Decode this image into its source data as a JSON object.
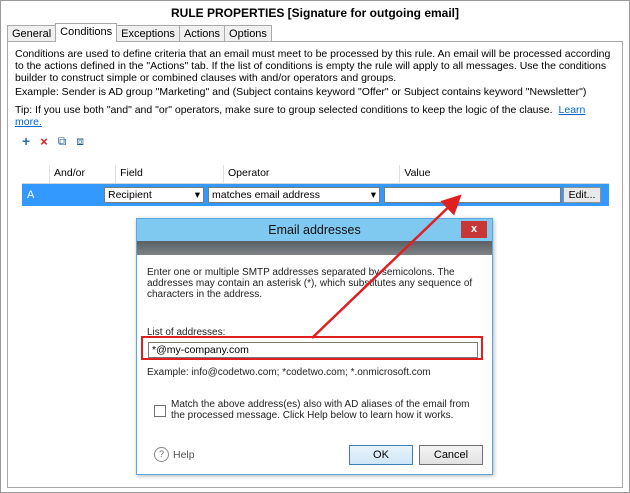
{
  "window": {
    "title": "RULE PROPERTIES [Signature for outgoing email]"
  },
  "tabs": [
    {
      "label": "General"
    },
    {
      "label": "Conditions"
    },
    {
      "label": "Exceptions"
    },
    {
      "label": "Actions"
    },
    {
      "label": "Options"
    }
  ],
  "active_tab": "Conditions",
  "description": {
    "para1": "Conditions are used to define criteria that an email must meet to be processed by this rule. An email will be processed according to the actions defined in the \"Actions\" tab. If the list of conditions is empty the rule will apply to all messages. Use the conditions builder to construct simple or combined clauses with and/or operators and groups.",
    "example": "Example: Sender is AD group \"Marketing\" and (Subject contains keyword \"Offer\" or Subject contains keyword \"Newsletter\")",
    "tip": "Tip: If you use both \"and\" and \"or\" operators, make sure to group selected conditions to keep the logic of the clause.",
    "learn_more": "Learn more."
  },
  "toolbar": {
    "add": "+",
    "delete": "×",
    "group": "⧉",
    "ungroup": "⧈"
  },
  "grid": {
    "headers": [
      "",
      "And/or",
      "Field",
      "Operator",
      "Value"
    ],
    "rows": [
      {
        "id": "A",
        "andor": "",
        "field": "Recipient",
        "operator": "matches email address",
        "value": "",
        "edit_label": "Edit..."
      }
    ]
  },
  "dialog": {
    "title": "Email addresses",
    "close": "x",
    "intro": "Enter one or multiple SMTP addresses separated by semicolons. The addresses may contain an asterisk (*), which substitutes any sequence of characters in the address.",
    "list_label": "List of addresses:",
    "list_value": "*@my-company.com",
    "example": "Example: info@codetwo.com; *codetwo.com; *.onmicrosoft.com",
    "checkbox_label": "Match the above address(es) also with AD aliases of the email from the processed message. Click Help below to learn how it works.",
    "checkbox_checked": false,
    "help": "Help",
    "ok": "OK",
    "cancel": "Cancel"
  },
  "colors": {
    "selection": "#3399ff",
    "dialog_title": "#7fc8ef",
    "highlight": "#e02020",
    "link": "#0066cc"
  }
}
